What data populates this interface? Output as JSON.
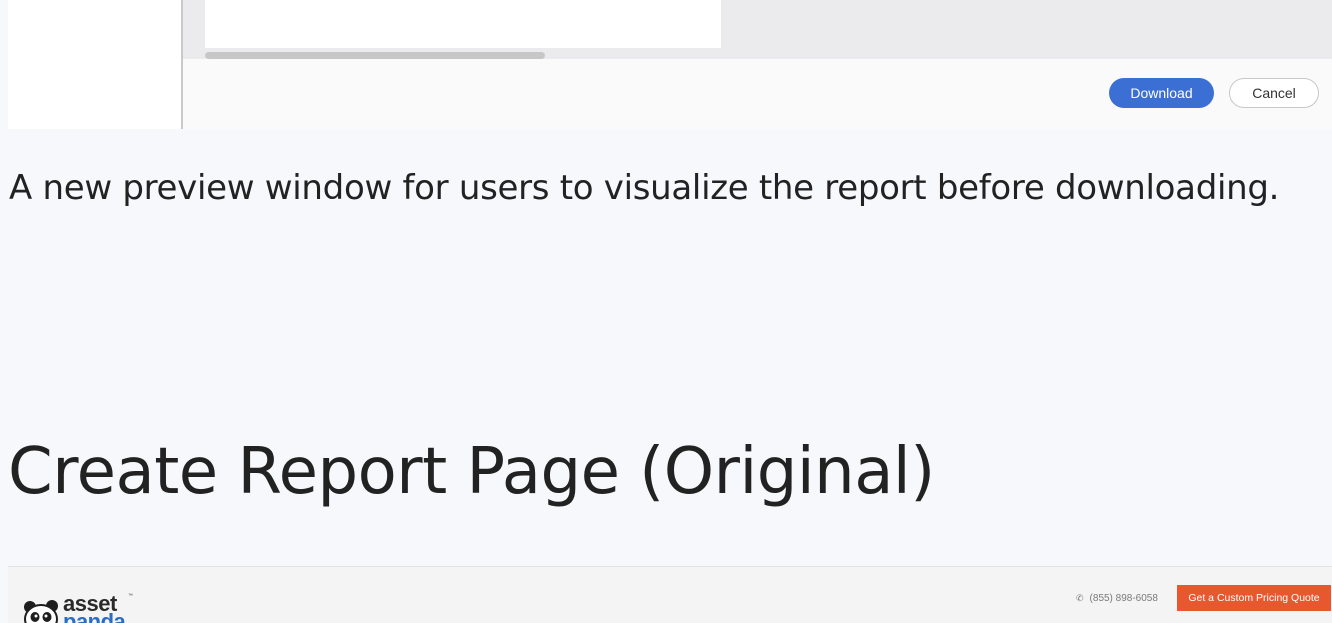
{
  "preview_dialog": {
    "download_label": "Download",
    "cancel_label": "Cancel"
  },
  "caption": "A new preview window for users to visualize the report before downloading.",
  "section_heading": "Create Report Page (Original)",
  "site_header": {
    "logo_line1": "asset",
    "logo_line2": "panda",
    "logo_tm": "™",
    "phone": "(855) 898-6058",
    "quote_button": "Get a Custom Pricing Quote",
    "colors": {
      "quote_button_bg": "#e8582f",
      "logo_blue": "#2b6cc4"
    }
  },
  "colors": {
    "download_button_bg": "#3b6fd4",
    "page_bg": "#f7f8fb"
  }
}
